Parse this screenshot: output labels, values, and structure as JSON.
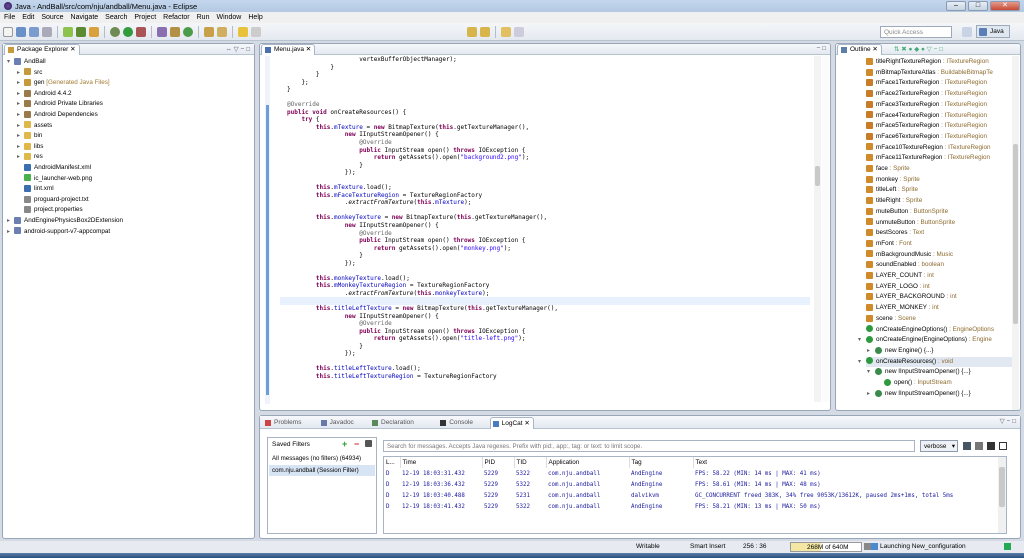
{
  "window": {
    "title": "Java - AndBall/src/com/nju/andball/Menu.java - Eclipse",
    "min": "–",
    "max": "□",
    "close": "✕"
  },
  "menu": [
    "File",
    "Edit",
    "Source",
    "Navigate",
    "Search",
    "Project",
    "Refactor",
    "Run",
    "Window",
    "Help"
  ],
  "toolbar": {
    "quick_access_placeholder": "Quick Access",
    "perspective": "Java"
  },
  "package_explorer": {
    "tab": "Package Explorer",
    "items": [
      {
        "label": "AndBall",
        "indent": 0,
        "twisty": "▾",
        "icon": "project"
      },
      {
        "label": "src",
        "indent": 1,
        "twisty": "▸",
        "icon": "folder-src"
      },
      {
        "label": "gen",
        "suffix": " [Generated Java Files]",
        "indent": 1,
        "twisty": "▸",
        "icon": "folder-src"
      },
      {
        "label": "Android 4.4.2",
        "indent": 1,
        "twisty": "▸",
        "icon": "library"
      },
      {
        "label": "Android Private Libraries",
        "indent": 1,
        "twisty": "▸",
        "icon": "library"
      },
      {
        "label": "Android Dependencies",
        "indent": 1,
        "twisty": "▸",
        "icon": "library"
      },
      {
        "label": "assets",
        "indent": 1,
        "twisty": "▸",
        "icon": "folder"
      },
      {
        "label": "bin",
        "indent": 1,
        "twisty": "▸",
        "icon": "folder"
      },
      {
        "label": "libs",
        "indent": 1,
        "twisty": "▸",
        "icon": "folder"
      },
      {
        "label": "res",
        "indent": 1,
        "twisty": "▸",
        "icon": "folder"
      },
      {
        "label": "AndroidManifest.xml",
        "indent": 1,
        "twisty": "",
        "icon": "xml"
      },
      {
        "label": "ic_launcher-web.png",
        "indent": 1,
        "twisty": "",
        "icon": "image"
      },
      {
        "label": "lint.xml",
        "indent": 1,
        "twisty": "",
        "icon": "xml"
      },
      {
        "label": "proguard-project.txt",
        "indent": 1,
        "twisty": "",
        "icon": "file"
      },
      {
        "label": "project.properties",
        "indent": 1,
        "twisty": "",
        "icon": "file"
      },
      {
        "label": "AndEnginePhysicsBox2DExtension",
        "indent": 0,
        "twisty": "▸",
        "icon": "project"
      },
      {
        "label": "android-support-v7-appcompat",
        "indent": 0,
        "twisty": "▸",
        "icon": "project"
      }
    ]
  },
  "editor": {
    "tab": "Menu.java",
    "lines": [
      [
        [
          "t",
          "                    vertexBufferObjectManager);"
        ]
      ],
      [
        [
          "t",
          "            }"
        ]
      ],
      [
        [
          "t",
          "        }"
        ]
      ],
      [
        [
          "t",
          "    };"
        ]
      ],
      [
        [
          "t",
          "}"
        ]
      ],
      [
        [
          "t",
          ""
        ]
      ],
      [
        [
          "a",
          "@Override"
        ]
      ],
      [
        [
          "k",
          "public void"
        ],
        [
          "t",
          " onCreateResources() {"
        ]
      ],
      [
        [
          "t",
          "    "
        ],
        [
          "k",
          "try"
        ],
        [
          "t",
          " {"
        ]
      ],
      [
        [
          "t",
          "        "
        ],
        [
          "k",
          "this"
        ],
        [
          "t",
          "."
        ],
        [
          "f",
          "mTexture"
        ],
        [
          "t",
          " = "
        ],
        [
          "k",
          "new"
        ],
        [
          "t",
          " BitmapTexture("
        ],
        [
          "k",
          "this"
        ],
        [
          "t",
          ".getTextureManager(),"
        ]
      ],
      [
        [
          "t",
          "                "
        ],
        [
          "k",
          "new"
        ],
        [
          "t",
          " IInputStreamOpener() {"
        ]
      ],
      [
        [
          "t",
          "                    "
        ],
        [
          "a",
          "@Override"
        ]
      ],
      [
        [
          "t",
          "                    "
        ],
        [
          "k",
          "public"
        ],
        [
          "t",
          " InputStream open() "
        ],
        [
          "k",
          "throws"
        ],
        [
          "t",
          " IOException {"
        ]
      ],
      [
        [
          "t",
          "                        "
        ],
        [
          "k",
          "return"
        ],
        [
          "t",
          " getAssets().open("
        ],
        [
          "s",
          "\"background2.png\""
        ],
        [
          "t",
          ");"
        ]
      ],
      [
        [
          "t",
          "                    }"
        ]
      ],
      [
        [
          "t",
          "                });"
        ]
      ],
      [
        [
          "t",
          ""
        ]
      ],
      [
        [
          "t",
          "        "
        ],
        [
          "k",
          "this"
        ],
        [
          "t",
          "."
        ],
        [
          "f",
          "mTexture"
        ],
        [
          "t",
          ".load();"
        ]
      ],
      [
        [
          "t",
          "        "
        ],
        [
          "k",
          "this"
        ],
        [
          "t",
          "."
        ],
        [
          "f",
          "mFaceTextureRegion"
        ],
        [
          "t",
          " = TextureRegionFactory"
        ]
      ],
      [
        [
          "t",
          "                ."
        ],
        [
          "i",
          "extractFromTexture"
        ],
        [
          "t",
          "("
        ],
        [
          "k",
          "this"
        ],
        [
          "t",
          "."
        ],
        [
          "f",
          "mTexture"
        ],
        [
          "t",
          ");"
        ]
      ],
      [
        [
          "t",
          ""
        ]
      ],
      [
        [
          "t",
          "        "
        ],
        [
          "k",
          "this"
        ],
        [
          "t",
          "."
        ],
        [
          "f",
          "monkeyTexture"
        ],
        [
          "t",
          " = "
        ],
        [
          "k",
          "new"
        ],
        [
          "t",
          " BitmapTexture("
        ],
        [
          "k",
          "this"
        ],
        [
          "t",
          ".getTextureManager(),"
        ]
      ],
      [
        [
          "t",
          "                "
        ],
        [
          "k",
          "new"
        ],
        [
          "t",
          " IInputStreamOpener() {"
        ]
      ],
      [
        [
          "t",
          "                    "
        ],
        [
          "a",
          "@Override"
        ]
      ],
      [
        [
          "t",
          "                    "
        ],
        [
          "k",
          "public"
        ],
        [
          "t",
          " InputStream open() "
        ],
        [
          "k",
          "throws"
        ],
        [
          "t",
          " IOException {"
        ]
      ],
      [
        [
          "t",
          "                        "
        ],
        [
          "k",
          "return"
        ],
        [
          "t",
          " getAssets().open("
        ],
        [
          "s",
          "\"monkey.png\""
        ],
        [
          "t",
          ");"
        ]
      ],
      [
        [
          "t",
          "                    }"
        ]
      ],
      [
        [
          "t",
          "                });"
        ]
      ],
      [
        [
          "t",
          ""
        ]
      ],
      [
        [
          "t",
          "        "
        ],
        [
          "k",
          "this"
        ],
        [
          "t",
          "."
        ],
        [
          "f",
          "monkeyTexture"
        ],
        [
          "t",
          ".load();"
        ]
      ],
      [
        [
          "t",
          "        "
        ],
        [
          "k",
          "this"
        ],
        [
          "t",
          "."
        ],
        [
          "f",
          "mMonkeyTextureRegion"
        ],
        [
          "t",
          " = TextureRegionFactory"
        ]
      ],
      [
        [
          "t",
          "                ."
        ],
        [
          "i",
          "extractFromTexture"
        ],
        [
          "t",
          "("
        ],
        [
          "k",
          "this"
        ],
        [
          "t",
          "."
        ],
        [
          "f",
          "monkeyTexture"
        ],
        [
          "t",
          ");"
        ]
      ],
      [
        [
          "t",
          ""
        ]
      ],
      [
        [
          "t",
          "        "
        ],
        [
          "k",
          "this"
        ],
        [
          "t",
          "."
        ],
        [
          "f",
          "titleLeftTexture"
        ],
        [
          "t",
          " = "
        ],
        [
          "k",
          "new"
        ],
        [
          "t",
          " BitmapTexture("
        ],
        [
          "k",
          "this"
        ],
        [
          "t",
          ".getTextureManager(),"
        ]
      ],
      [
        [
          "t",
          "                "
        ],
        [
          "k",
          "new"
        ],
        [
          "t",
          " IInputStreamOpener() {"
        ]
      ],
      [
        [
          "t",
          "                    "
        ],
        [
          "a",
          "@Override"
        ]
      ],
      [
        [
          "t",
          "                    "
        ],
        [
          "k",
          "public"
        ],
        [
          "t",
          " InputStream open() "
        ],
        [
          "k",
          "throws"
        ],
        [
          "t",
          " IOException {"
        ]
      ],
      [
        [
          "t",
          "                        "
        ],
        [
          "k",
          "return"
        ],
        [
          "t",
          " getAssets().open("
        ],
        [
          "s",
          "\"title-left.png\""
        ],
        [
          "t",
          ");"
        ]
      ],
      [
        [
          "t",
          "                    }"
        ]
      ],
      [
        [
          "t",
          "                });"
        ]
      ],
      [
        [
          "t",
          ""
        ]
      ],
      [
        [
          "t",
          "        "
        ],
        [
          "k",
          "this"
        ],
        [
          "t",
          "."
        ],
        [
          "f",
          "titleLeftTexture"
        ],
        [
          "t",
          ".load();"
        ]
      ],
      [
        [
          "t",
          "        "
        ],
        [
          "k",
          "this"
        ],
        [
          "t",
          "."
        ],
        [
          "f",
          "titleLeftTextureRegion"
        ],
        [
          "t",
          " = TextureRegionFactory"
        ]
      ]
    ]
  },
  "outline": {
    "tab": "Outline",
    "items": [
      {
        "name": "titleRightTextureRegion",
        "type": " : ITextureRegion",
        "icon": "field",
        "indent": 0
      },
      {
        "name": "mBitmapTextureAtlas",
        "type": " : BuildableBitmapTe",
        "icon": "field",
        "indent": 0
      },
      {
        "name": "mFace1TextureRegion",
        "type": " : ITextureRegion",
        "icon": "field-w",
        "indent": 0
      },
      {
        "name": "mFace2TextureRegion",
        "type": " : ITextureRegion",
        "icon": "field-w",
        "indent": 0
      },
      {
        "name": "mFace3TextureRegion",
        "type": " : ITextureRegion",
        "icon": "field-w",
        "indent": 0
      },
      {
        "name": "mFace4TextureRegion",
        "type": " : ITextureRegion",
        "icon": "field-w",
        "indent": 0
      },
      {
        "name": "mFace5TextureRegion",
        "type": " : ITextureRegion",
        "icon": "field-w",
        "indent": 0
      },
      {
        "name": "mFace6TextureRegion",
        "type": " : ITextureRegion",
        "icon": "field-w",
        "indent": 0
      },
      {
        "name": "mFace10TextureRegion",
        "type": " : ITextureRegion",
        "icon": "field",
        "indent": 0
      },
      {
        "name": "mFace11TextureRegion",
        "type": " : ITextureRegion",
        "icon": "field",
        "indent": 0
      },
      {
        "name": "face",
        "type": " : Sprite",
        "icon": "field",
        "indent": 0
      },
      {
        "name": "monkey",
        "type": " : Sprite",
        "icon": "field",
        "indent": 0
      },
      {
        "name": "titleLeft",
        "type": " : Sprite",
        "icon": "field",
        "indent": 0
      },
      {
        "name": "titleRight",
        "type": " : Sprite",
        "icon": "field",
        "indent": 0
      },
      {
        "name": "muteButton",
        "type": " : ButtonSprite",
        "icon": "field",
        "indent": 0
      },
      {
        "name": "unmuteButton",
        "type": " : ButtonSprite",
        "icon": "field",
        "indent": 0
      },
      {
        "name": "bestScores",
        "type": " : Text",
        "icon": "field",
        "indent": 0
      },
      {
        "name": "mFont",
        "type": " : Font",
        "icon": "field",
        "indent": 0
      },
      {
        "name": "mBackgroundMusic",
        "type": " : Music",
        "icon": "field",
        "indent": 0
      },
      {
        "name": "soundEnabled",
        "type": " : boolean",
        "icon": "field",
        "indent": 0
      },
      {
        "name": "LAYER_COUNT",
        "type": " : int",
        "icon": "field",
        "indent": 0
      },
      {
        "name": "LAYER_LOGO",
        "type": " : int",
        "icon": "field",
        "indent": 0
      },
      {
        "name": "LAYER_BACKGROUND",
        "type": " : int",
        "icon": "field",
        "indent": 0
      },
      {
        "name": "LAYER_MONKEY",
        "type": " : int",
        "icon": "field",
        "indent": 0
      },
      {
        "name": "scene",
        "type": " : Scene",
        "icon": "field",
        "indent": 0
      },
      {
        "name": "onCreateEngineOptions()",
        "type": " : EngineOptions",
        "icon": "method",
        "indent": 0
      },
      {
        "name": "onCreateEngine(EngineOptions)",
        "type": " : Engine",
        "icon": "method",
        "indent": 0,
        "twisty": "▾"
      },
      {
        "name": "new Engine() {...}",
        "type": "",
        "icon": "class",
        "indent": 1,
        "twisty": "▸"
      },
      {
        "name": "onCreateResources()",
        "type": " : void",
        "icon": "method",
        "indent": 0,
        "twisty": "▾",
        "selected": true
      },
      {
        "name": "new IInputStreamOpener() {...}",
        "type": "",
        "icon": "class",
        "indent": 1,
        "twisty": "▾"
      },
      {
        "name": "open()",
        "type": " : InputStream",
        "icon": "method",
        "indent": 2
      },
      {
        "name": "new IInputStreamOpener() {...}",
        "type": "",
        "icon": "class",
        "indent": 1,
        "twisty": "▸"
      }
    ]
  },
  "bottom_tabs": [
    "Problems",
    "Javadoc",
    "Declaration",
    "Console",
    "LogCat"
  ],
  "logcat": {
    "saved_filters_title": "Saved Filters",
    "filters": [
      "All messages (no filters) (64934)",
      "com.nju.andball (Session Filter)"
    ],
    "search_placeholder": "Search for messages. Accepts Java regexes. Prefix with pid:, app:, tag: or text: to limit scope.",
    "level_select": "verbose",
    "columns": [
      "L...",
      "Time",
      "PID",
      "TID",
      "Application",
      "Tag",
      "Text"
    ],
    "rows": [
      [
        "D",
        "12-19 18:03:31.432",
        "5229",
        "5322",
        "com.nju.andball",
        "AndEngine",
        "FPS: 58.22 (MIN: 14 ms | MAX: 41 ms)"
      ],
      [
        "D",
        "12-19 18:03:36.432",
        "5229",
        "5322",
        "com.nju.andball",
        "AndEngine",
        "FPS: 58.61 (MIN: 14 ms | MAX: 48 ms)"
      ],
      [
        "D",
        "12-19 18:03:40.488",
        "5229",
        "5231",
        "com.nju.andball",
        "dalvikvm",
        "GC_CONCURRENT freed 383K, 34% free 9053K/13612K, paused 2ms+1ms, total 5ms"
      ],
      [
        "D",
        "12-19 18:03:41.432",
        "5229",
        "5322",
        "com.nju.andball",
        "AndEngine",
        "FPS: 58.21 (MIN: 13 ms | MAX: 50 ms)"
      ]
    ]
  },
  "status": {
    "mode": "Writable",
    "insert": "Smart Insert",
    "position": "256 : 36",
    "heap": "268M of 640M",
    "task": "Launching New_configuration"
  }
}
